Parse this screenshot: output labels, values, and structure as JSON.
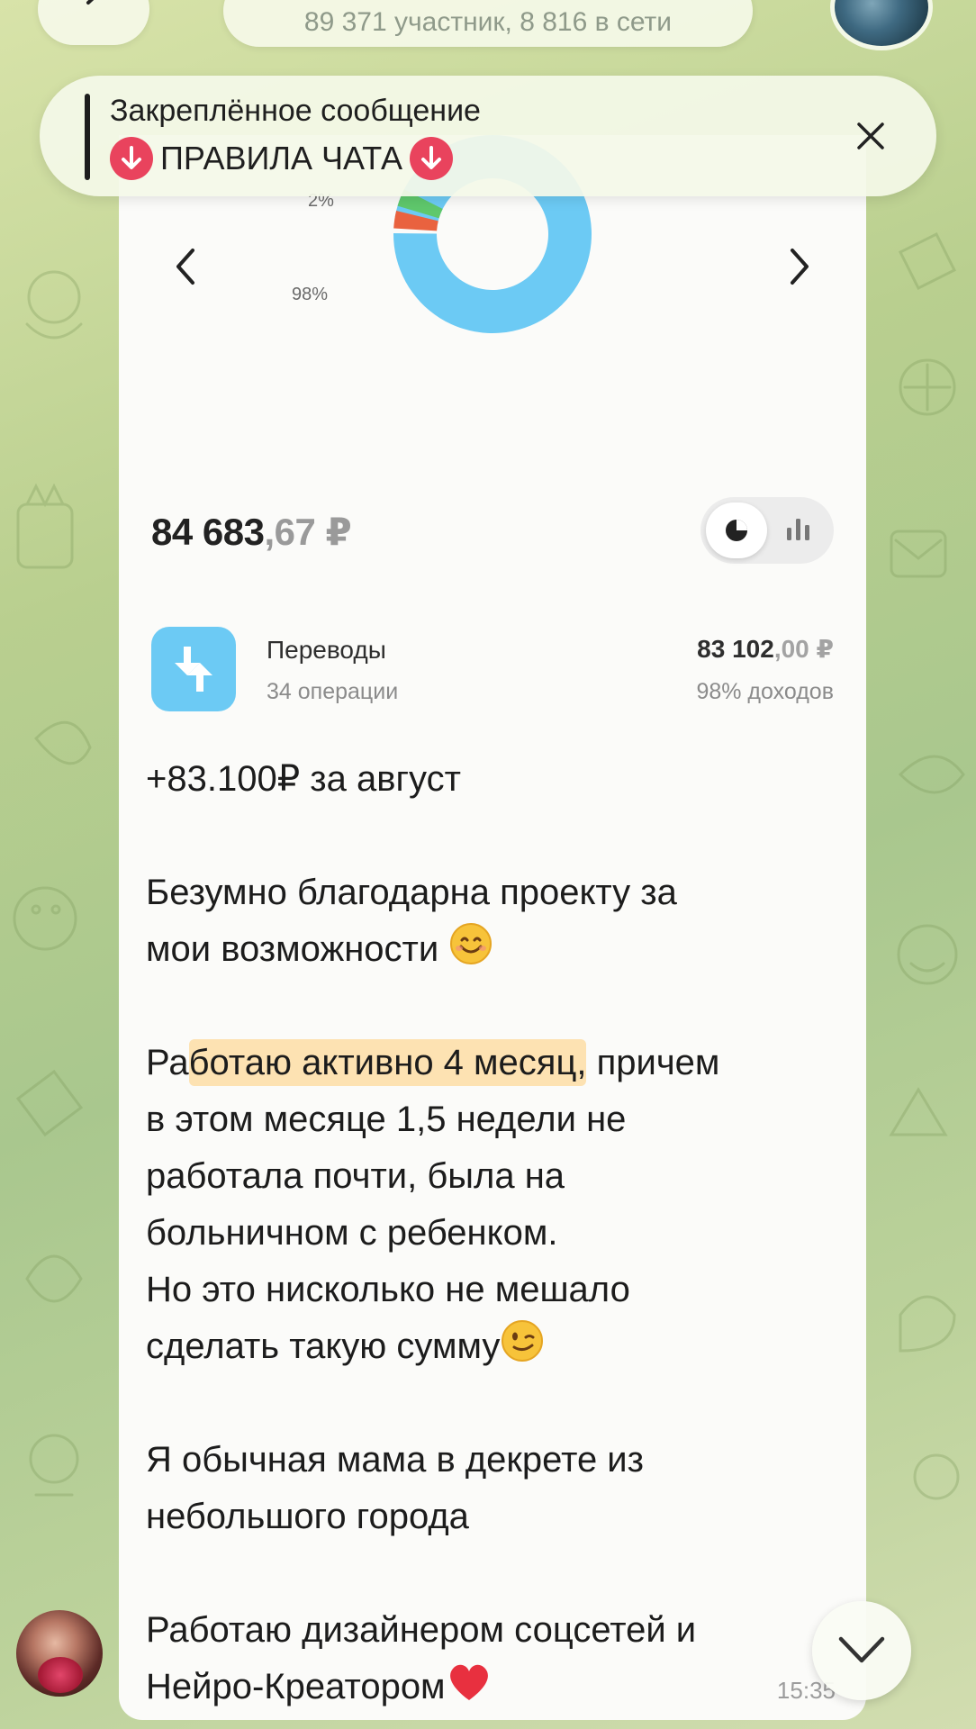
{
  "header": {
    "subtitle": "89 371 участник, 8 816 в сети"
  },
  "pinned": {
    "title": "Закреплённое сообщение",
    "text": "ПРАВИЛА ЧАТА"
  },
  "screenshot": {
    "chart": {
      "type": "pie",
      "slices": [
        {
          "label": "98%",
          "value": 98,
          "color": "#6ccaf4"
        },
        {
          "label": "",
          "value": 1.5,
          "color": "#e9623f"
        },
        {
          "label": "2%",
          "value": 0.5,
          "color": "#5fc86c"
        }
      ]
    },
    "balance_int": "84 683",
    "balance_dec": ",67 ₽",
    "category": {
      "name": "Переводы",
      "count": "34 операции",
      "amount_int": "83 102",
      "amount_dec": ",00 ₽",
      "share": "98% доходов"
    }
  },
  "message": {
    "line1": "+83.100₽ за август",
    "line2": "Безумно благодарна проекту за",
    "line3": "мои возможности",
    "line4_pre": "Ра",
    "line4_hl": "ботаю активно 4 месяц,",
    "line4_post": " причем",
    "line5": "в этом месяце 1,5 недели не",
    "line6": "работала почти, была на",
    "line7": "больничном с ребенком.",
    "line8": "Но это нисколько не мешало",
    "line9": "сделать такую сумму",
    "line10": "Я обычная мама в декрете из",
    "line11": "небольшого города",
    "line12": "Работаю дизайнером соцсетей и",
    "line13": "Нейро-Креатором",
    "time": "15:35"
  },
  "colors": {
    "accent_blue": "#6ccaf4",
    "badge_red": "#e9435d",
    "highlight": "#fde2b2"
  },
  "icons": [
    "back-icon",
    "close-icon",
    "arrow-down-icon",
    "chevron-left-icon",
    "chevron-right-icon",
    "pie-chart-icon",
    "bar-chart-icon",
    "transfer-icon",
    "smile-emoji",
    "wink-emoji",
    "heart-emoji",
    "chevron-down-icon"
  ]
}
